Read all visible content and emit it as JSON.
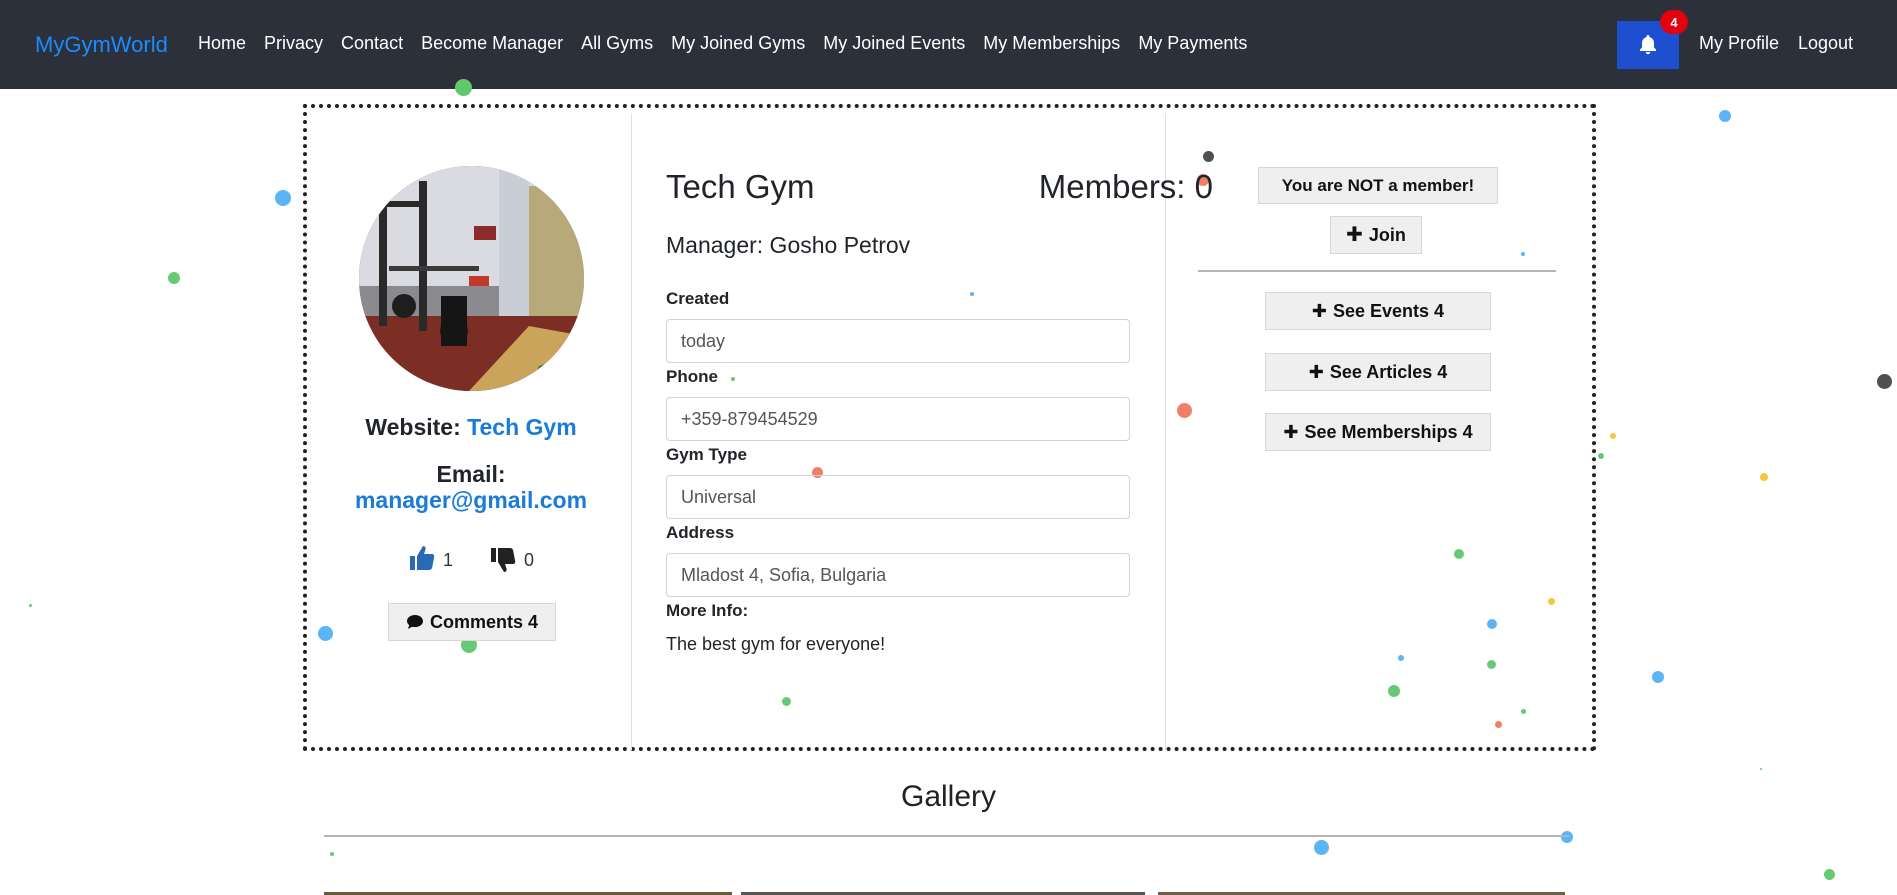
{
  "navbar": {
    "brand": "MyGymWorld",
    "links": [
      "Home",
      "Privacy",
      "Contact",
      "Become Manager",
      "All Gyms",
      "My Joined Gyms",
      "My Joined Events",
      "My Memberships",
      "My Payments"
    ],
    "notification_count": "4",
    "profile": "My Profile",
    "logout": "Logout"
  },
  "gym": {
    "website_label": "Website:",
    "website_value": "Tech Gym",
    "email_label": "Email:",
    "email_value": "manager@gmail.com",
    "likes": "1",
    "dislikes": "0",
    "comments_button": "Comments 4",
    "name": "Tech Gym",
    "members": "Members: 0",
    "manager": "Manager: Gosho Petrov",
    "fields": {
      "created_label": "Created",
      "created_value": "today",
      "phone_label": "Phone",
      "phone_value": "+359-879454529",
      "type_label": "Gym Type",
      "type_value": "Universal",
      "address_label": "Address",
      "address_value": "Mladost 4, Sofia, Bulgaria",
      "more_label": "More Info:",
      "more_value": "The best gym for everyone!"
    },
    "membership_status": "You are NOT a member!",
    "join_button": "Join",
    "events_button": "See Events 4",
    "articles_button": "See Articles 4",
    "memberships_button": "See Memberships 4"
  },
  "gallery": {
    "title": "Gallery"
  },
  "colors": {
    "navbar_bg": "#2b303b",
    "brand": "#1a8cff",
    "bell_button": "#1f4fd1",
    "badge": "#e3000f",
    "link": "#1a7bd8"
  }
}
